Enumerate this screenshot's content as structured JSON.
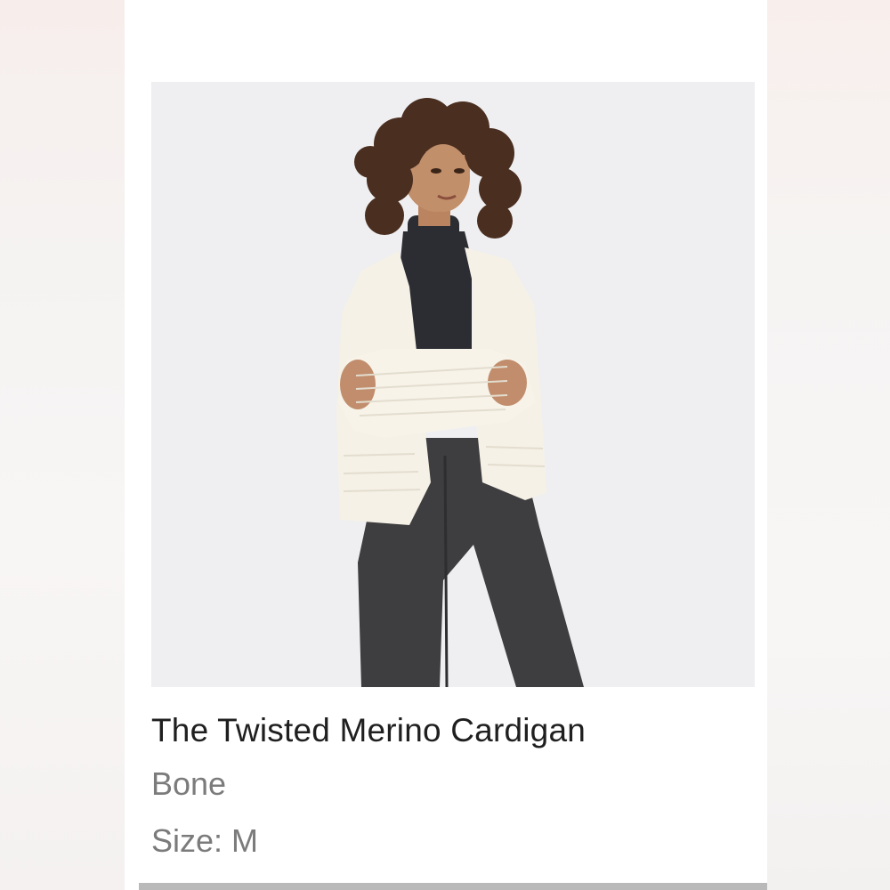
{
  "product": {
    "name": "The Twisted Merino Cardigan",
    "color": "Bone",
    "size": "Size: M"
  },
  "image": {
    "icon": "product-photo",
    "background_color": "#efeff1"
  },
  "colors": {
    "card": "#ffffff",
    "title_text": "#1f1f1f",
    "meta_text": "#7b7b7b",
    "bottom_bar": "#b9b9b9"
  }
}
